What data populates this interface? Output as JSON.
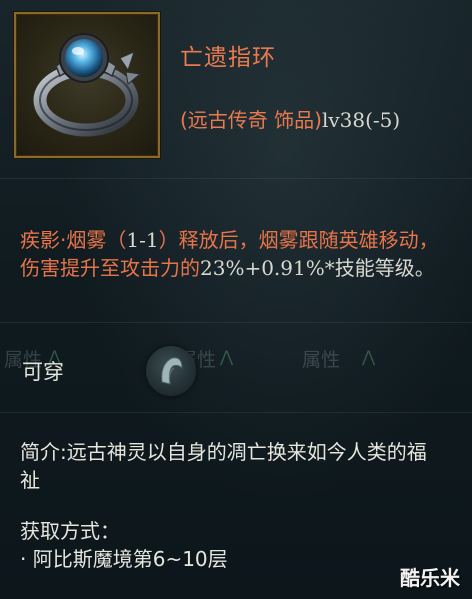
{
  "item": {
    "icon": "silver-ring-with-blue-gem",
    "name": "亡遗指环",
    "type_label": "(远古传奇 饰品)",
    "level_label": "lv38(-5)"
  },
  "effect": {
    "part1": "疾影·烟雾（",
    "part2": "1-1",
    "part3": "）释放后，烟雾跟随英雄移动，伤害提升至攻击力的",
    "part4": "23%+0.91%*",
    "part5": "技能等级。"
  },
  "equip": {
    "label": "可穿",
    "badge_icon": "hood-icon"
  },
  "background_ghost": {
    "attr_label_1": "属性",
    "attr_label_2": "属性",
    "attr_label_3": "属性"
  },
  "description": {
    "text": "简介:远古神灵以自身的凋亡换来如今人类的福祉"
  },
  "obtain": {
    "title": "获取方式：",
    "source": "· 阿比斯魔境第6~10层"
  },
  "watermark": "酷乐米",
  "colors": {
    "legendary_orange": "#ea7a4e",
    "frame_gold": "#8a6a2a",
    "text_white": "#e6e6de"
  }
}
